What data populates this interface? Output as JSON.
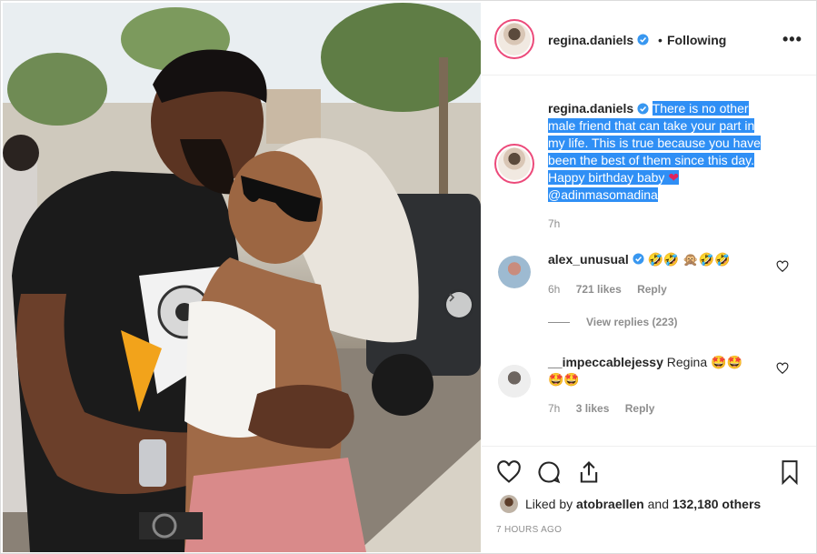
{
  "header": {
    "username": "regina.daniels",
    "separator": "•",
    "follow_status": "Following",
    "more_icon": "more-horizontal-icon"
  },
  "caption": {
    "username": "regina.daniels",
    "text_line1": "There is no other",
    "text_line2": "male friend that can take your part in",
    "text_line3": "my life. This is true because you have",
    "text_line4": "been the best of them since this day.",
    "text_line5": "Happy birthday baby",
    "heart": "❤",
    "mention": "@adinmasomadina",
    "time": "7h"
  },
  "comments": [
    {
      "username": "alex_unusual",
      "verified": true,
      "text": "🤣🤣 🙊🤣🤣",
      "time": "6h",
      "likes": "721 likes",
      "reply": "Reply",
      "view_replies": "View replies (223)"
    },
    {
      "username": "__impeccablejessy",
      "verified": false,
      "text": "Regina 🤩🤩",
      "text2": "🤩🤩",
      "time": "7h",
      "likes": "3 likes",
      "reply": "Reply"
    }
  ],
  "actions": {
    "liked_by_prefix": "Liked by",
    "liked_by_user": "atobraellen",
    "liked_by_and": "and",
    "liked_by_count": "132,180 others",
    "posted": "7 HOURS AGO"
  },
  "colors": {
    "verified_blue": "#3897f0",
    "highlight": "#2f8ff5",
    "muted": "#8e8e8e",
    "text": "#262626"
  }
}
